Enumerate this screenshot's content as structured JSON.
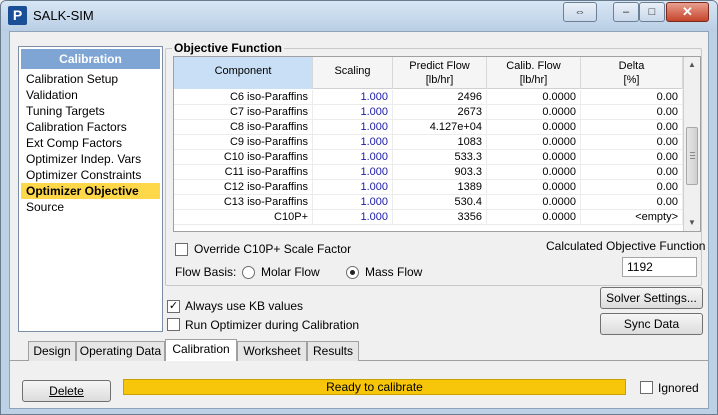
{
  "window": {
    "title": "SALK-SIM",
    "app_icon_letter": "P",
    "controls": {
      "restore": "⇔",
      "minimize": "–",
      "maximize": "□",
      "close": "✕"
    }
  },
  "nav": {
    "header": "Calibration",
    "items": [
      "Calibration Setup",
      "Validation",
      "Tuning Targets",
      "Calibration Factors",
      "Ext Comp Factors",
      "Optimizer Indep. Vars",
      "Optimizer Constraints",
      "Optimizer Objective",
      "Source"
    ],
    "selected": "Optimizer Objective"
  },
  "objective": {
    "group_title": "Objective Function",
    "columns": [
      {
        "line1": "Component",
        "line2": ""
      },
      {
        "line1": "Scaling",
        "line2": ""
      },
      {
        "line1": "Predict Flow",
        "line2": "[lb/hr]"
      },
      {
        "line1": "Calib. Flow",
        "line2": "[lb/hr]"
      },
      {
        "line1": "Delta",
        "line2": "[%]"
      }
    ],
    "rows": [
      [
        "C6 iso-Paraffins",
        "1.000",
        "2496",
        "0.0000",
        "0.00"
      ],
      [
        "C7 iso-Paraffins",
        "1.000",
        "2673",
        "0.0000",
        "0.00"
      ],
      [
        "C8 iso-Paraffins",
        "1.000",
        "4.127e+04",
        "0.0000",
        "0.00"
      ],
      [
        "C9 iso-Paraffins",
        "1.000",
        "1083",
        "0.0000",
        "0.00"
      ],
      [
        "C10 iso-Paraffins",
        "1.000",
        "533.3",
        "0.0000",
        "0.00"
      ],
      [
        "C11 iso-Paraffins",
        "1.000",
        "903.3",
        "0.0000",
        "0.00"
      ],
      [
        "C12 iso-Paraffins",
        "1.000",
        "1389",
        "0.0000",
        "0.00"
      ],
      [
        "C13 iso-Paraffins",
        "1.000",
        "530.4",
        "0.0000",
        "0.00"
      ],
      [
        "C10P+",
        "1.000",
        "3356",
        "0.0000",
        "<empty>"
      ]
    ],
    "override_label": "Override C10P+ Scale Factor",
    "override_checked": false,
    "calc_label": "Calculated Objective Function",
    "calc_value": "1192",
    "flow_basis_label": "Flow Basis:",
    "flow_options": [
      "Molar Flow",
      "Mass Flow"
    ],
    "flow_selected": "Mass Flow"
  },
  "options": {
    "always_kb_label": "Always use KB values",
    "always_kb_checked": true,
    "run_optimizer_label": "Run Optimizer during Calibration",
    "run_optimizer_checked": false
  },
  "buttons": {
    "solver_settings": "Solver Settings...",
    "sync_data": "Sync Data",
    "delete": "Delete"
  },
  "tabs": [
    "Design",
    "Operating Data",
    "Calibration",
    "Worksheet",
    "Results"
  ],
  "active_tab": "Calibration",
  "status": {
    "text": "Ready to calibrate",
    "color": "#f7c60a"
  },
  "ignored": {
    "label": "Ignored",
    "checked": false
  },
  "colors": {
    "nav_header": "#7ea5d4",
    "nav_selected": "#ffd84a",
    "scaling_text": "#1a1aa6"
  }
}
